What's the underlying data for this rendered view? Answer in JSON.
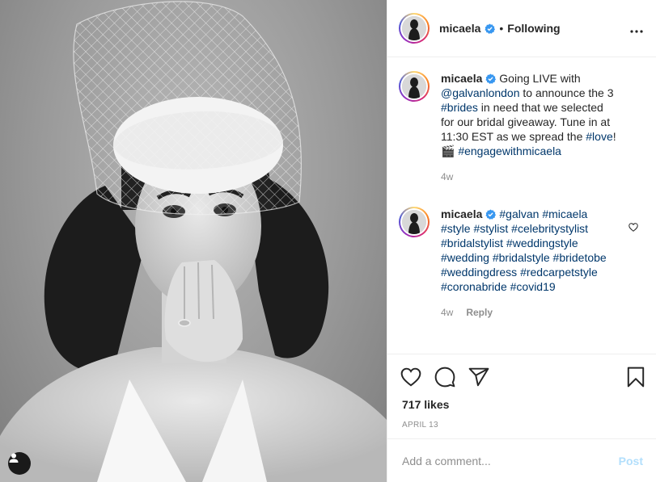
{
  "post": {
    "author": "micaela",
    "follow_status": "Following",
    "more_icon": "more-horizontal-icon",
    "separator": "•"
  },
  "caption": {
    "username": "micaela",
    "segments": [
      {
        "type": "text",
        "value": " Going LIVE with "
      },
      {
        "type": "mention",
        "value": "@galvanlondon"
      },
      {
        "type": "text",
        "value": " to announce the 3 "
      },
      {
        "type": "tag",
        "value": "#brides"
      },
      {
        "type": "text",
        "value": " in need that we selected for our bridal giveaway. Tune in at 11:30 EST as we spread the "
      },
      {
        "type": "tag",
        "value": "#love"
      },
      {
        "type": "text",
        "value": "! 🎬 "
      },
      {
        "type": "tag",
        "value": "#engagewithmicaela"
      }
    ],
    "age": "4w"
  },
  "comment": {
    "username": "micaela",
    "tags": [
      "#galvan",
      "#micaela",
      "#style",
      "#stylist",
      "#celebritystylist",
      "#bridalstylist",
      "#weddingstyle",
      "#wedding",
      "#bridalstyle",
      "#bridetobe",
      "#weddingdress",
      "#redcarpetstyle",
      "#coronabride",
      "#covid19"
    ],
    "age": "4w",
    "reply_label": "Reply"
  },
  "stats": {
    "likes": "717 likes",
    "date": "APRIL 13"
  },
  "composer": {
    "placeholder": "Add a comment...",
    "post_label": "Post"
  },
  "colors": {
    "link": "#00376b",
    "verified": "#3897f0",
    "muted": "#8e8e8e",
    "post_disabled": "#b2dffc"
  }
}
